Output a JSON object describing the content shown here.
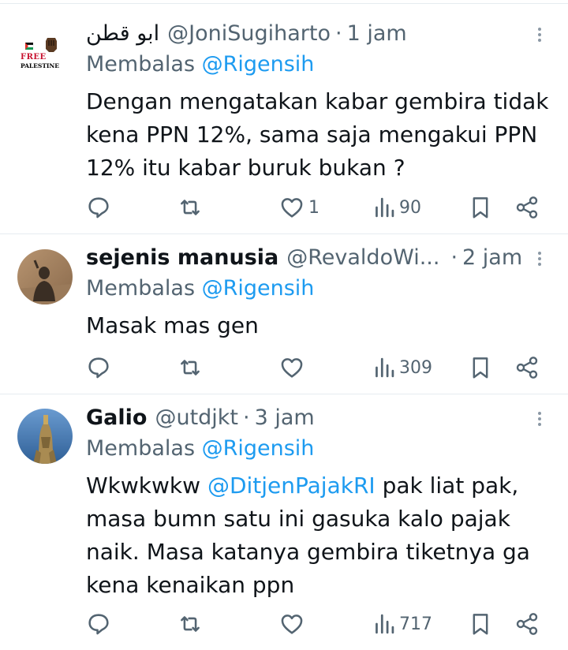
{
  "tweets": [
    {
      "name": "ابو قطن",
      "handle": "@JoniSugiharto",
      "separator": "·",
      "time": "1 jam",
      "avatar_badge": {
        "line1": "FREE",
        "line2": "PALESTINE"
      },
      "replying_prefix": "Membalas",
      "replying_to": "@Rigensih",
      "text_lines": [
        "Dengan mengatakan kabar gembira tidak",
        "kena PPN 12%, sama saja mengakui PPN",
        "12% itu kabar buruk bukan ?"
      ],
      "likes": "1",
      "views": "90"
    },
    {
      "name": "sejenis manusia",
      "handle": "@RevaldoWi...",
      "separator": "·",
      "time": "2 jam",
      "replying_prefix": "Membalas",
      "replying_to": "@Rigensih",
      "text_lines": [
        "Masak mas gen"
      ],
      "likes": "",
      "views": "309"
    },
    {
      "name": "Galio",
      "handle": "@utdjkt",
      "separator": "·",
      "time": "3 jam",
      "replying_prefix": "Membalas",
      "replying_to": "@Rigensih",
      "text_mention": "@DitjenPajakRI",
      "text_line1_before": "Wkwkwkw ",
      "text_line1_after": " pak liat pak,",
      "text_lines_rest": [
        "masa bumn satu ini gasuka kalo pajak",
        "naik. Masa katanya gembira tiketnya ga",
        "kena kenaikan ppn"
      ],
      "likes": "",
      "views": "717"
    }
  ],
  "colors": {
    "link": "#1d9bf0",
    "secondary": "#536471",
    "text": "#0f1419",
    "divider": "#e6ecf0"
  },
  "icons": [
    "reply-icon",
    "retweet-icon",
    "like-icon",
    "views-icon",
    "bookmark-icon",
    "share-icon",
    "more-icon"
  ]
}
